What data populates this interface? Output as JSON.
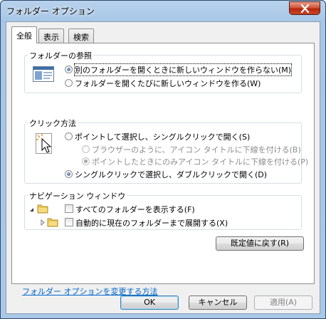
{
  "window": {
    "title": "フォルダー オプション"
  },
  "tabs": [
    {
      "label": "全般",
      "active": true
    },
    {
      "label": "表示",
      "active": false
    },
    {
      "label": "検索",
      "active": false
    }
  ],
  "browse_group": {
    "title": "フォルダーの参照",
    "options": [
      {
        "label": "別のフォルダーを開くときに新しいウィンドウを作らない(M)",
        "checked": true
      },
      {
        "label": "フォルダーを開くたびに新しいウィンドウを作る(W)",
        "checked": false
      }
    ]
  },
  "click_group": {
    "title": "クリック方法",
    "options": [
      {
        "label": "ポイントして選択し、シングルクリックで開く(S)",
        "checked": false
      },
      {
        "label": "ブラウザーのように、アイコン タイトルに下線を付ける(B)",
        "checked": false,
        "disabled": true
      },
      {
        "label": "ポイントしたときにのみアイコン タイトルに下線を付ける(P)",
        "checked": true,
        "disabled": true
      },
      {
        "label": "シングルクリックで選択し、ダブルクリックで開く(D)",
        "checked": true
      }
    ]
  },
  "nav_group": {
    "title": "ナビゲーション ウィンドウ",
    "options": [
      {
        "label": "すべてのフォルダーを表示する(F)",
        "checked": false
      },
      {
        "label": "自動的に現在のフォルダーまで展開する(X)",
        "checked": false
      }
    ]
  },
  "restore_defaults_label": "既定値に戻す(R)",
  "help_link": "フォルダー オプションを変更する方法",
  "buttons": {
    "ok": "OK",
    "cancel": "キャンセル",
    "apply": "適用(A)"
  },
  "colors": {
    "titlebar": "#a9c8e7",
    "close": "#c7452a",
    "link": "#0066cc",
    "default_button": "#3c7fb1"
  },
  "icons": [
    "close-icon",
    "folder-window-icon",
    "click-cursor-icon",
    "tree-expanded-icon",
    "tree-collapsed-icon",
    "folder-icon"
  ]
}
